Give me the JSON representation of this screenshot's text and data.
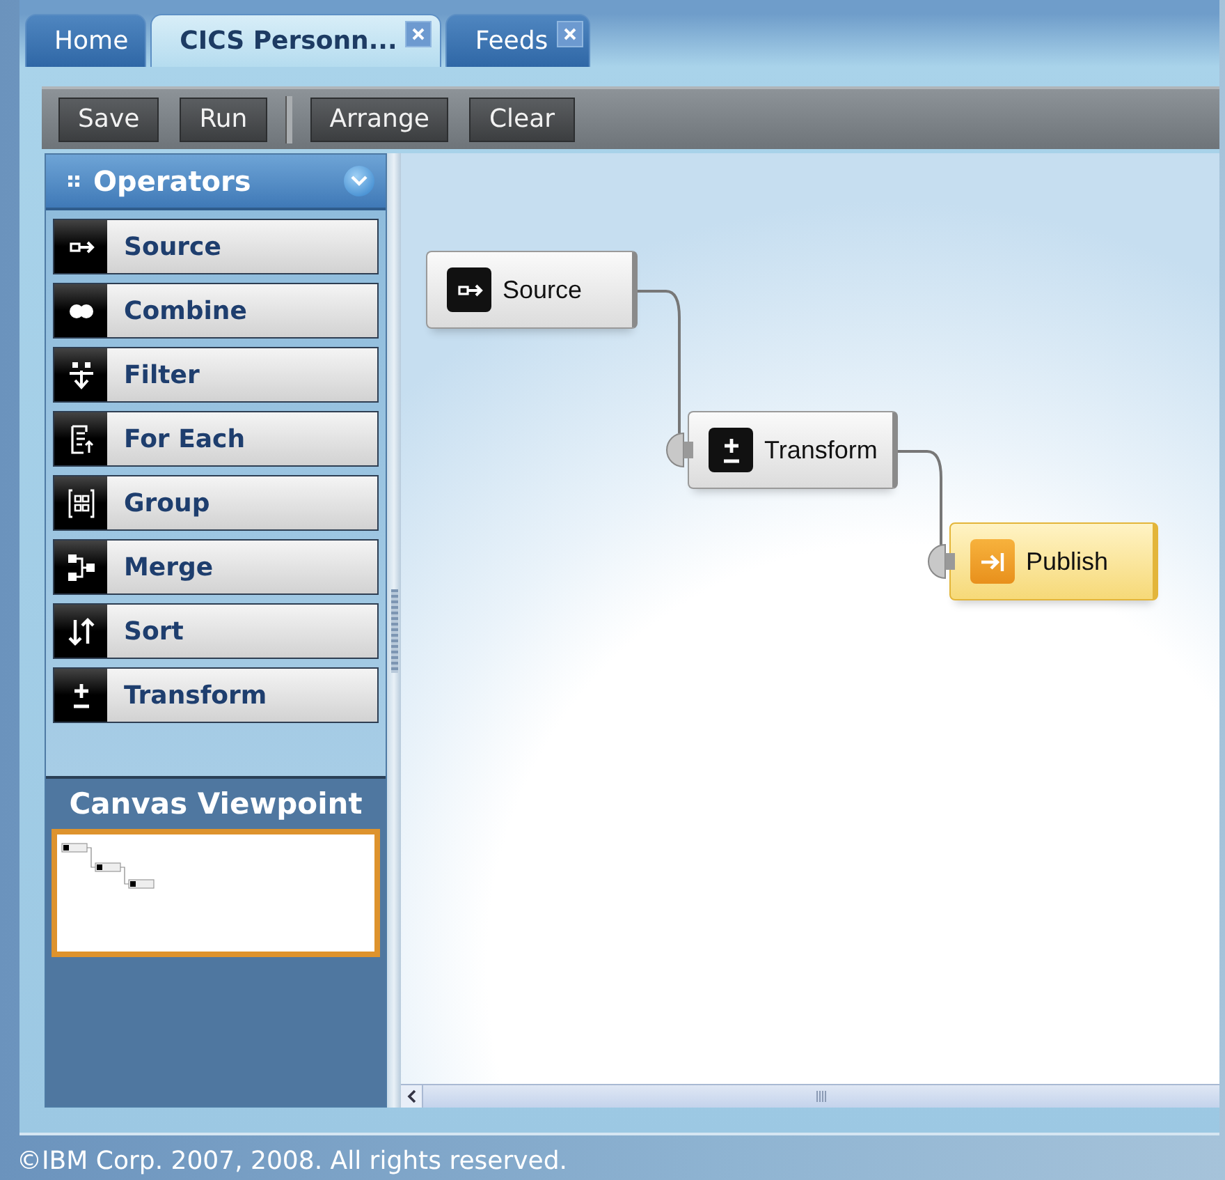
{
  "tabs": [
    {
      "label": "Home",
      "selected": false,
      "closable": false
    },
    {
      "label": "CICS Personn...",
      "selected": true,
      "closable": true
    },
    {
      "label": "Feeds",
      "selected": false,
      "closable": true
    }
  ],
  "toolbar": {
    "buttons": [
      {
        "label": "Save",
        "kind": "button"
      },
      {
        "label": "Run",
        "kind": "button"
      },
      {
        "kind": "separator"
      },
      {
        "label": "Arrange",
        "kind": "button"
      },
      {
        "label": "Clear",
        "kind": "button"
      }
    ]
  },
  "operators_panel": {
    "title": "Operators",
    "expanded": true,
    "items": [
      {
        "label": "Source",
        "kind": "source"
      },
      {
        "label": "Combine",
        "kind": "combine"
      },
      {
        "label": "Filter",
        "kind": "filter"
      },
      {
        "label": "For Each",
        "kind": "foreach"
      },
      {
        "label": "Group",
        "kind": "group"
      },
      {
        "label": "Merge",
        "kind": "merge"
      },
      {
        "label": "Sort",
        "kind": "sort"
      },
      {
        "label": "Transform",
        "kind": "transform"
      }
    ]
  },
  "canvas_viewpoint": {
    "title": "Canvas Viewpoint"
  },
  "canvas": {
    "nodes": [
      {
        "label": "Source",
        "kind": "source",
        "selected": false
      },
      {
        "label": "Transform",
        "kind": "transform",
        "selected": false
      },
      {
        "label": "Publish",
        "kind": "publish",
        "selected": true
      }
    ]
  },
  "footer": {
    "text": "©IBM Corp. 2007, 2008. All rights reserved."
  }
}
